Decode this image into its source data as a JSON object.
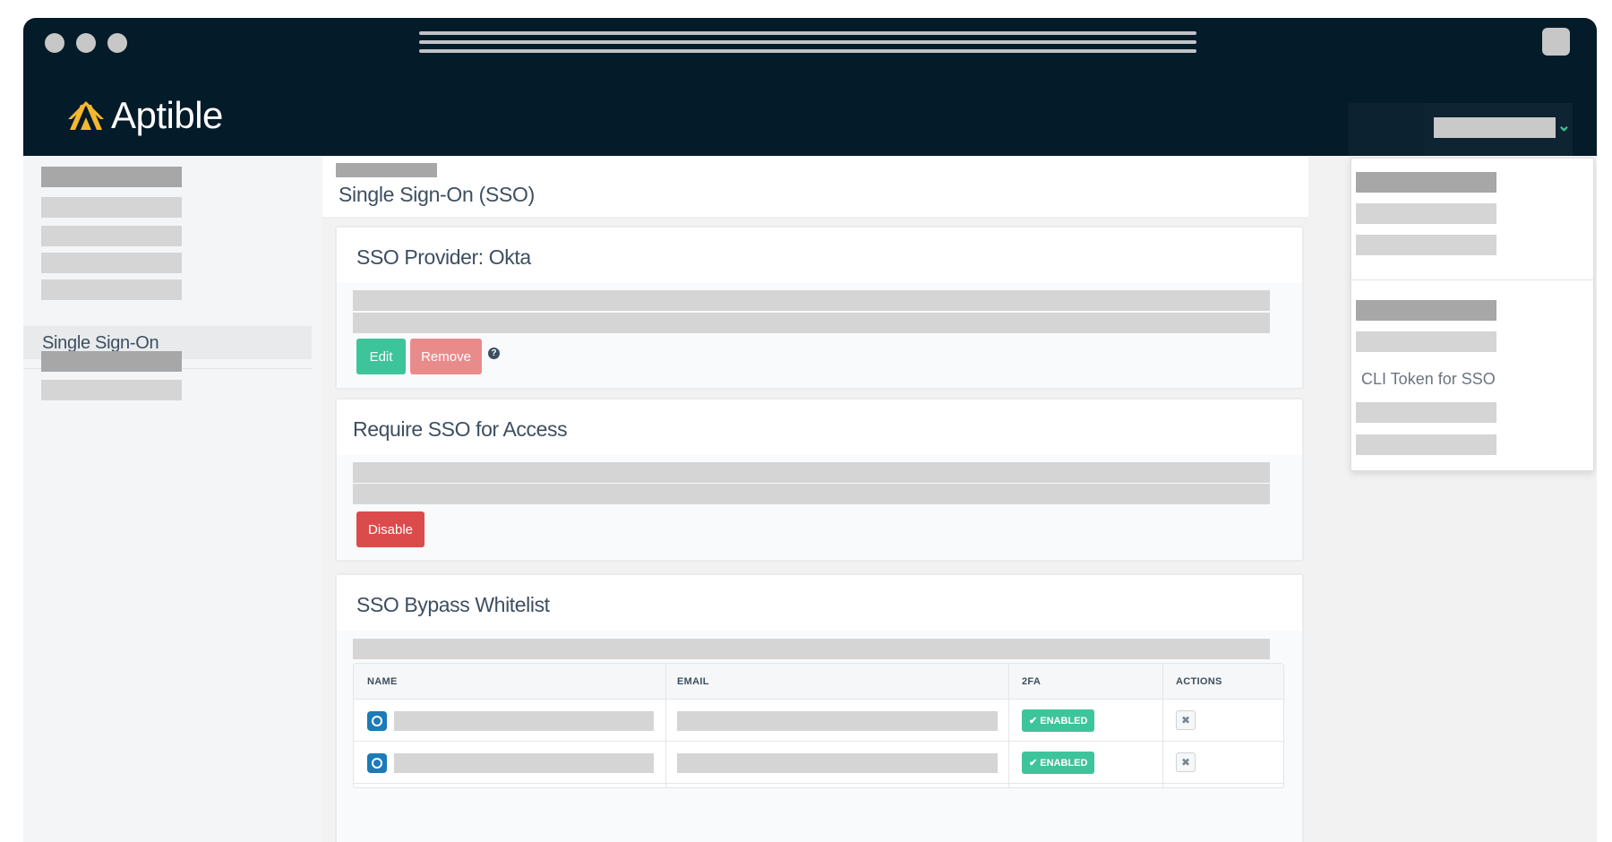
{
  "app": {
    "brand": "Aptible",
    "brand_color": "#f5b82e",
    "header_bg": "#041b29",
    "accent": "#3ec49a"
  },
  "header": {
    "account_menu_icon": "chevron-down-icon"
  },
  "sidebar": {
    "active_item": "Single Sign-On"
  },
  "page": {
    "title": "Single Sign-On (SSO)"
  },
  "sso_provider": {
    "title": "SSO Provider: Okta",
    "edit_label": "Edit",
    "remove_label": "Remove",
    "help_icon": "?"
  },
  "require_sso": {
    "title": "Require SSO for Access",
    "disable_label": "Disable"
  },
  "whitelist": {
    "title": "SSO Bypass Whitelist",
    "columns": [
      "NAME",
      "EMAIL",
      "2FA",
      "ACTIONS"
    ],
    "rows": [
      {
        "twofa": "✔ ENABLED",
        "action": "✖"
      },
      {
        "twofa": "✔ ENABLED",
        "action": "✖"
      }
    ]
  },
  "dropdown": {
    "item_label": "CLI Token for SSO"
  }
}
